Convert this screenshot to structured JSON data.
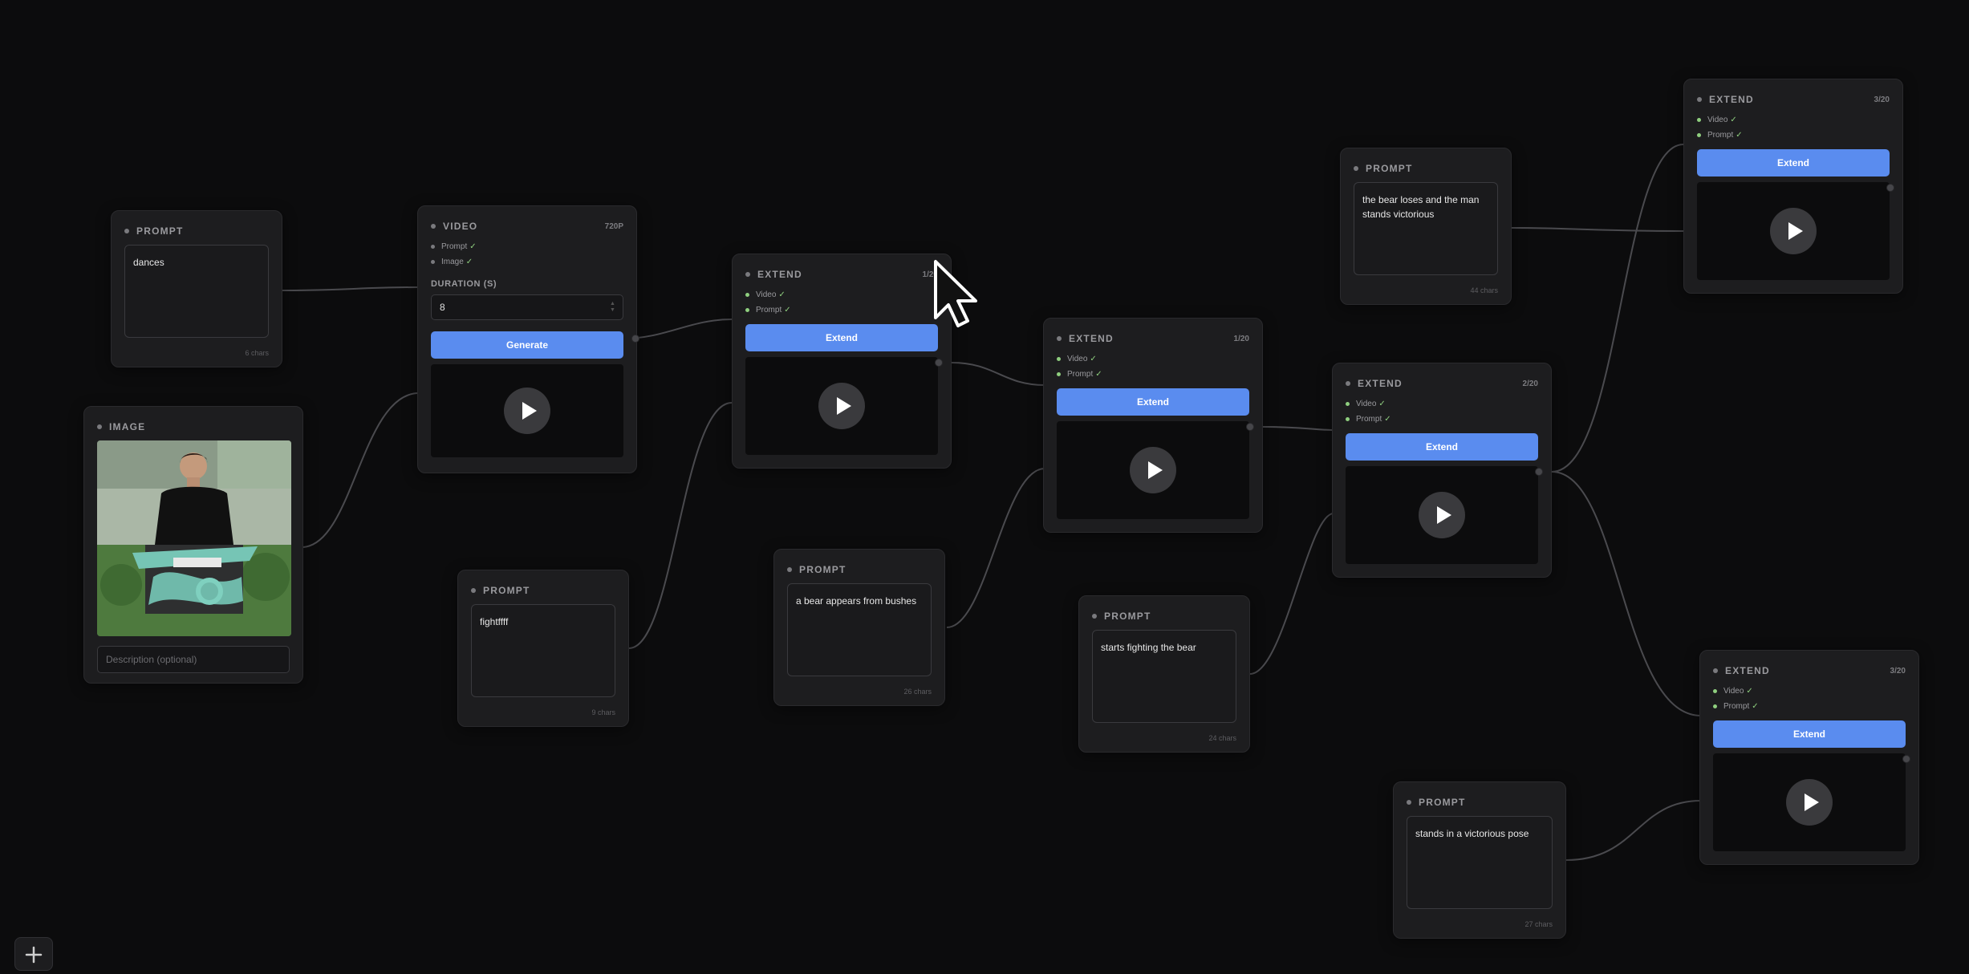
{
  "nodes": {
    "prompt1": {
      "title": "PROMPT",
      "text": "dances",
      "chars": "6 chars"
    },
    "image1": {
      "title": "IMAGE",
      "description_placeholder": "Description (optional)"
    },
    "video1": {
      "title": "VIDEO",
      "meta": "720P",
      "inputs": [
        {
          "label": "Prompt",
          "check": "✓"
        },
        {
          "label": "Image",
          "check": "✓"
        }
      ],
      "duration_label": "DURATION (S)",
      "duration_value": "8",
      "button": "Generate"
    },
    "prompt2": {
      "title": "PROMPT",
      "text": "fightffff",
      "chars": "9 chars"
    },
    "extend1": {
      "title": "EXTEND",
      "meta": "1/20",
      "inputs": [
        {
          "label": "Video",
          "check": "✓"
        },
        {
          "label": "Prompt",
          "check": "✓"
        }
      ],
      "button": "Extend"
    },
    "prompt3": {
      "title": "PROMPT",
      "text": "a bear appears from bushes",
      "chars": "26 chars"
    },
    "extend2": {
      "title": "EXTEND",
      "meta": "1/20",
      "inputs": [
        {
          "label": "Video",
          "check": "✓"
        },
        {
          "label": "Prompt",
          "check": "✓"
        }
      ],
      "button": "Extend"
    },
    "prompt4": {
      "title": "PROMPT",
      "text": "starts fighting the bear",
      "chars": "24 chars"
    },
    "extend3": {
      "title": "EXTEND",
      "meta": "2/20",
      "inputs": [
        {
          "label": "Video",
          "check": "✓"
        },
        {
          "label": "Prompt",
          "check": "✓"
        }
      ],
      "button": "Extend"
    },
    "prompt5": {
      "title": "PROMPT",
      "text": "the bear loses and the man stands victorious",
      "chars": "44 chars"
    },
    "extend4": {
      "title": "EXTEND",
      "meta": "3/20",
      "inputs": [
        {
          "label": "Video",
          "check": "✓"
        },
        {
          "label": "Prompt",
          "check": "✓"
        }
      ],
      "button": "Extend"
    },
    "prompt6": {
      "title": "PROMPT",
      "text": "stands in a victorious pose",
      "chars": "27 chars"
    },
    "extend5": {
      "title": "EXTEND",
      "meta": "3/20",
      "inputs": [
        {
          "label": "Video",
          "check": "✓"
        },
        {
          "label": "Prompt",
          "check": "✓"
        }
      ],
      "button": "Extend"
    }
  },
  "colors": {
    "background": "#0c0c0d",
    "node": "#1d1d1f",
    "accent": "#5a8cef",
    "check": "#8fcf7f",
    "wire": "#4a4a4e"
  },
  "icons": {
    "play": "play-icon",
    "add": "plus-icon",
    "cursor": "mouse-cursor-icon"
  }
}
